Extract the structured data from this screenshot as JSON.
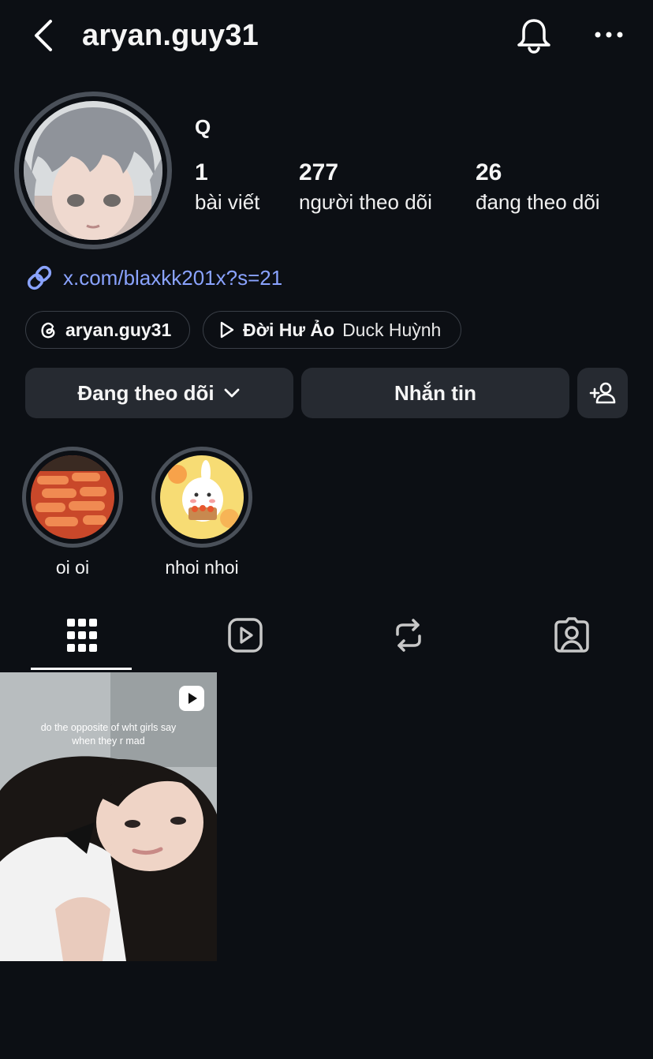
{
  "header": {
    "username": "aryan.guy31",
    "icons": [
      "back-icon",
      "bell-icon",
      "more-icon"
    ]
  },
  "profile": {
    "display_name": "Q",
    "stats": [
      {
        "value": "1",
        "label": "bài viết"
      },
      {
        "value": "277",
        "label": "người theo dõi"
      },
      {
        "value": "26",
        "label": "đang theo dõi"
      }
    ],
    "link": "x.com/blaxkk201x?s=21",
    "threads_chip": "aryan.guy31",
    "music_chip": {
      "title": "Đời Hư Ảo",
      "artist": "Duck Huỳnh"
    }
  },
  "actions": {
    "following": "Đang theo dõi",
    "message": "Nhắn tin"
  },
  "highlights": [
    {
      "label": "oi oi"
    },
    {
      "label": "nhoi nhoi"
    }
  ],
  "tabs": [
    "grid-icon",
    "reels-icon",
    "reposts-icon",
    "tagged-icon"
  ],
  "posts": [
    {
      "caption_line1": "do the opposite of wht girls say",
      "caption_line2": "when they r mad"
    }
  ],
  "colors": {
    "background": "#0c0f14",
    "button": "#262a31",
    "link": "#8aa3ff",
    "ring": "#4a5059"
  }
}
